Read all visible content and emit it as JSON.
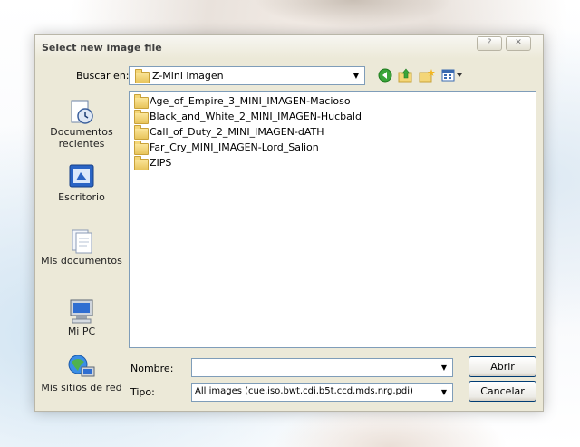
{
  "dialog": {
    "title": "Select new image file",
    "help_glyph": "?",
    "close_glyph": "✕"
  },
  "lookin": {
    "label": "Buscar en:",
    "value": "Z-Mini imagen"
  },
  "places": [
    {
      "label": "Documentos recientes",
      "icon": "recent-documents-icon"
    },
    {
      "label": "Escritorio",
      "icon": "desktop-icon"
    },
    {
      "label": "Mis documentos",
      "icon": "my-documents-icon"
    },
    {
      "label": "Mi PC",
      "icon": "my-computer-icon"
    },
    {
      "label": "Mis sitios de red",
      "icon": "network-places-icon"
    }
  ],
  "files": [
    "Age_of_Empire_3_MINI_IMAGEN-Macioso",
    "Black_and_White_2_MINI_IMAGEN-Hucbald",
    "Call_of_Duty_2_MINI_IMAGEN-dATH",
    "Far_Cry_MINI_IMAGEN-Lord_Salion",
    "ZIPS"
  ],
  "filename": {
    "label": "Nombre:",
    "value": ""
  },
  "filetype": {
    "label": "Tipo:",
    "value": "All images (cue,iso,bwt,cdi,b5t,ccd,mds,nrg,pdi)"
  },
  "buttons": {
    "open": "Abrir",
    "cancel": "Cancelar"
  },
  "colors": {
    "dialog_bg": "#ece9d8",
    "border_blue": "#7f9db9"
  }
}
